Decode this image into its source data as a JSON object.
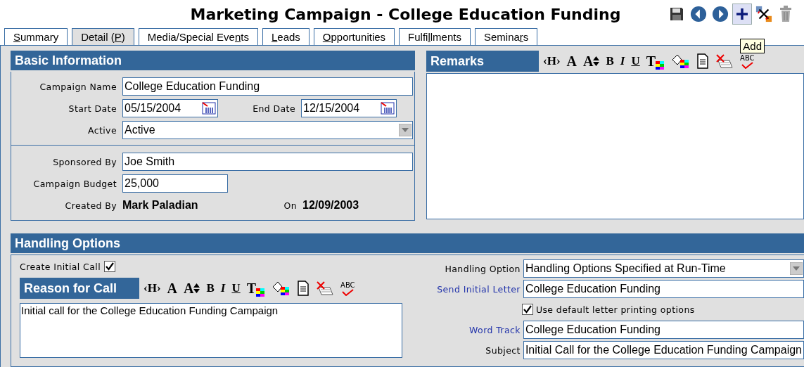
{
  "window": {
    "title": "Marketing Campaign - College Education Funding"
  },
  "toolbar": [
    {
      "kind": "save",
      "pressed": false
    },
    {
      "kind": "previous",
      "pressed": false
    },
    {
      "kind": "next",
      "pressed": false
    },
    {
      "kind": "add",
      "pressed": true
    },
    {
      "kind": "unlink",
      "pressed": false
    },
    {
      "kind": "delete",
      "pressed": false
    }
  ],
  "tooltip": "Add",
  "tabs": [
    {
      "label": {
        "key": "S",
        "after": "ummary"
      },
      "selected": false
    },
    {
      "label": {
        "before": "Detail (",
        "key": "P",
        "after": ")"
      },
      "selected": true
    },
    {
      "label": {
        "before": "Media/Special Eve",
        "key": "n",
        "after": "ts"
      },
      "selected": false
    },
    {
      "label": {
        "key": "L",
        "after": "eads"
      },
      "selected": false
    },
    {
      "label": {
        "key": "O",
        "after": "pportunities"
      },
      "selected": false
    },
    {
      "label": {
        "before": "Fulfi",
        "key": "l",
        "after": "lments"
      },
      "selected": false
    },
    {
      "label": {
        "before": "Semina",
        "key": "r",
        "after": "s"
      },
      "selected": false
    }
  ],
  "basic_information": {
    "title": "Basic Information",
    "campaign_name": {
      "label": "Campaign Name",
      "value": "College Education Funding"
    },
    "start_date": {
      "label": "Start Date",
      "value": "05/15/2004"
    },
    "end_date": {
      "label": "End Date",
      "value": "12/15/2004"
    },
    "active": {
      "label": "Active",
      "value": "Active"
    },
    "sponsored_by": {
      "label": "Sponsored By",
      "value": "Joe Smith"
    },
    "campaign_budget": {
      "label": "Campaign Budget",
      "value": "25,000"
    },
    "created_by": {
      "label": "Created By",
      "value": "Mark Paladian"
    },
    "created_on": {
      "label": "On",
      "value": "12/09/2003"
    }
  },
  "remarks": {
    "title": "Remarks",
    "tools": [
      {
        "kind": "heading",
        "text": "‹H›"
      },
      {
        "kind": "font",
        "text": "A"
      },
      {
        "kind": "size",
        "text": "A"
      },
      {
        "kind": "bold",
        "text": "B"
      },
      {
        "kind": "italic",
        "text": "I"
      },
      {
        "kind": "underline",
        "text": "U"
      },
      {
        "kind": "text-color",
        "text": "T"
      },
      {
        "kind": "fill-color"
      },
      {
        "kind": "document"
      },
      {
        "kind": "clear"
      },
      {
        "kind": "spell",
        "text": "ABC"
      }
    ]
  },
  "handling_options": {
    "title": "Handling Options",
    "create_initial_call": {
      "label": "Create Initial Call",
      "checked": true
    },
    "reason_for_call": {
      "title": "Reason for Call",
      "value": "Initial call for the College Education Funding Campaign",
      "tools": [
        {
          "kind": "heading",
          "text": "‹H›"
        },
        {
          "kind": "font",
          "text": "A"
        },
        {
          "kind": "size",
          "text": "A"
        },
        {
          "kind": "bold",
          "text": "B"
        },
        {
          "kind": "italic",
          "text": "I"
        },
        {
          "kind": "underline",
          "text": "U"
        },
        {
          "kind": "text-color",
          "text": "T"
        },
        {
          "kind": "fill-color"
        },
        {
          "kind": "document"
        },
        {
          "kind": "clear"
        },
        {
          "kind": "spell",
          "text": "ABC"
        }
      ]
    },
    "fields": [
      {
        "kind": "select",
        "label": "Handling Option",
        "value": "Handling Options Specified at Run-Time",
        "link": false
      },
      {
        "kind": "text",
        "label": "Send Initial Letter",
        "value": "College Education Funding",
        "link": true
      },
      {
        "kind": "checkbox",
        "label": "Use default letter printing options",
        "checked": true
      },
      {
        "kind": "text",
        "label": "Word Track",
        "value": "College Education Funding",
        "link": true
      },
      {
        "kind": "text",
        "label": "Subject",
        "value": "Initial Call for the College Education Funding Campaign",
        "link": false
      }
    ]
  }
}
